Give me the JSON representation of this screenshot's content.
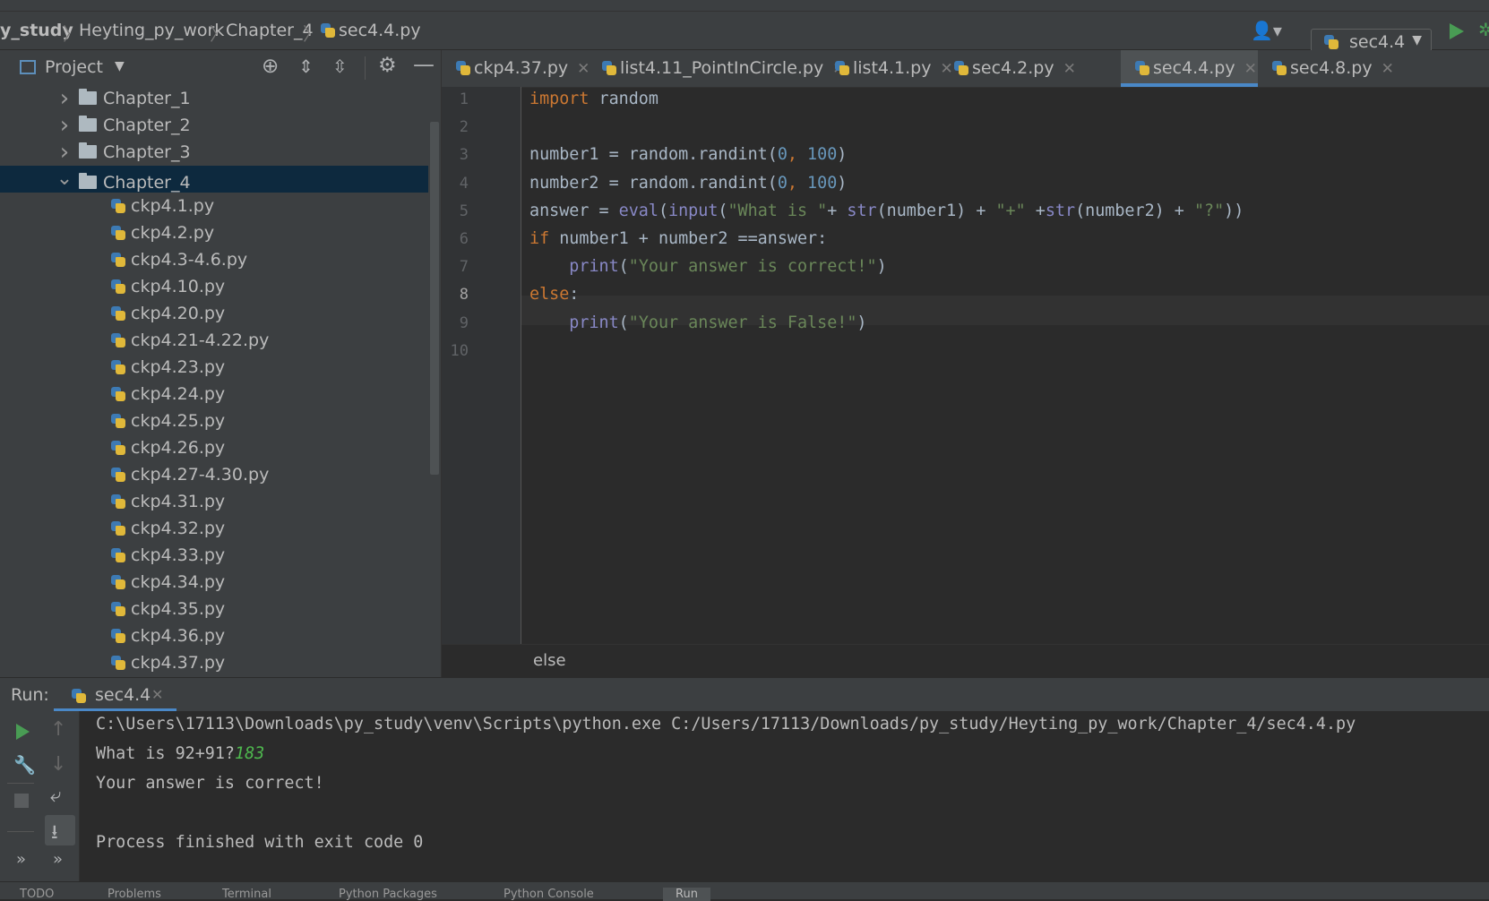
{
  "breadcrumb": {
    "items": [
      "y_study",
      "Heyting_py_work",
      "Chapter_4",
      "sec4.4.py"
    ]
  },
  "run_config": {
    "label": "sec4.4"
  },
  "project_panel": {
    "title": "Project",
    "tree": [
      {
        "label": "Chapter_1",
        "type": "folder",
        "expanded": false
      },
      {
        "label": "Chapter_2",
        "type": "folder",
        "expanded": false
      },
      {
        "label": "Chapter_3",
        "type": "folder",
        "expanded": false
      },
      {
        "label": "Chapter_4",
        "type": "folder",
        "expanded": true,
        "selected": true
      },
      {
        "label": "ckp4.1.py",
        "type": "file"
      },
      {
        "label": "ckp4.2.py",
        "type": "file"
      },
      {
        "label": "ckp4.3-4.6.py",
        "type": "file"
      },
      {
        "label": "ckp4.10.py",
        "type": "file"
      },
      {
        "label": "ckp4.20.py",
        "type": "file"
      },
      {
        "label": "ckp4.21-4.22.py",
        "type": "file"
      },
      {
        "label": "ckp4.23.py",
        "type": "file"
      },
      {
        "label": "ckp4.24.py",
        "type": "file"
      },
      {
        "label": "ckp4.25.py",
        "type": "file"
      },
      {
        "label": "ckp4.26.py",
        "type": "file"
      },
      {
        "label": "ckp4.27-4.30.py",
        "type": "file"
      },
      {
        "label": "ckp4.31.py",
        "type": "file"
      },
      {
        "label": "ckp4.32.py",
        "type": "file"
      },
      {
        "label": "ckp4.33.py",
        "type": "file"
      },
      {
        "label": "ckp4.34.py",
        "type": "file"
      },
      {
        "label": "ckp4.35.py",
        "type": "file"
      },
      {
        "label": "ckp4.36.py",
        "type": "file"
      },
      {
        "label": "ckp4.37.py",
        "type": "file"
      }
    ]
  },
  "editor": {
    "tabs": [
      {
        "label": "ckp4.37.py",
        "active": false
      },
      {
        "label": "list4.11_PointInCircle.py",
        "active": false
      },
      {
        "label": "list4.1.py",
        "active": false
      },
      {
        "label": "sec4.2.py",
        "active": false
      },
      {
        "label": "sec4.4.py",
        "active": true
      },
      {
        "label": "sec4.8.py",
        "active": false
      }
    ],
    "current_line": 8,
    "line_numbers": [
      "1",
      "2",
      "3",
      "4",
      "5",
      "6",
      "7",
      "8",
      "9",
      "10"
    ],
    "lines": [
      "import random",
      "",
      "number1 = random.randint(0, 100)",
      "number2 = random.randint(0, 100)",
      "answer = eval(input(\"What is \"+ str(number1) + \"+\" +str(number2) + \"?\"))",
      "if number1 + number2 ==answer:",
      "    print(\"Your answer is correct!\")",
      "else:",
      "    print(\"Your answer is False!\")",
      ""
    ],
    "footer_breadcrumb": "else"
  },
  "run_panel": {
    "label": "Run:",
    "tab": "sec4.4",
    "console": {
      "command": "C:\\Users\\17113\\Downloads\\py_study\\venv\\Scripts\\python.exe C:/Users/17113/Downloads/py_study/Heyting_py_work/Chapter_4/sec4.4.py",
      "prompt": "What is 92+91?",
      "user_input": "183",
      "result": "Your answer is correct!",
      "exit": "Process finished with exit code 0"
    }
  },
  "bottom_tabs": [
    "TODO",
    "Problems",
    "Terminal",
    "Python Packages",
    "Python Console",
    "Run"
  ],
  "colors": {
    "keyword": "#cc7832",
    "string": "#6a8759",
    "number": "#6897bb",
    "builtin": "#8888c6",
    "selection": "#0d293e",
    "accent": "#4a88c7",
    "run_green": "#499c54"
  }
}
